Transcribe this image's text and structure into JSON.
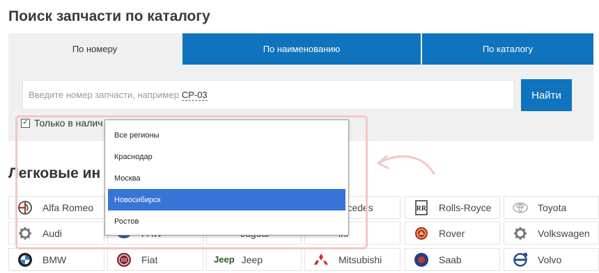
{
  "page": {
    "title": "Поиск запчасти по каталогу"
  },
  "tabs": [
    {
      "label": "По номеру",
      "active": true
    },
    {
      "label": "По наименованию",
      "active": false
    },
    {
      "label": "По каталогу",
      "active": false
    }
  ],
  "search": {
    "placeholder": "Введите номер запчасти, например",
    "example": "CP-03",
    "button": "Найти"
  },
  "availability": {
    "label": "Только в налич",
    "checked": true
  },
  "region_dropdown": {
    "options": [
      "Все регионы",
      "Краснодар",
      "Москва",
      "Новосибирск",
      "Ростов"
    ],
    "selected": "Новосибирск"
  },
  "section": {
    "title": "Легковые ин"
  },
  "brands": {
    "row1": [
      "Alfa Romeo",
      "ercedes",
      "Rolls-Royce",
      "Toyota"
    ],
    "row2": [
      "Audi",
      "FAW",
      "Jaguar",
      "ini",
      "Rover",
      "Volkswagen"
    ],
    "row3": [
      "BMW",
      "Fiat",
      "Jeep",
      "Mitsubishi",
      "Saab",
      "Volvo"
    ],
    "jeep_logo": "Jeep"
  },
  "colors": {
    "accent": "#0f74bd",
    "selected": "#3875d7",
    "highlight": "#f3c7c5"
  }
}
